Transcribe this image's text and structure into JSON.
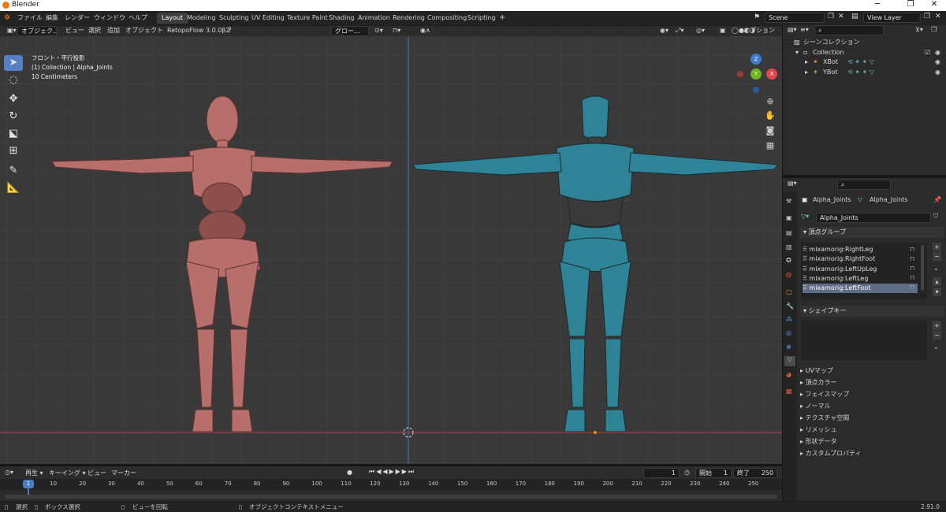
{
  "window": {
    "title": "Blender",
    "min": "─",
    "max": "❐",
    "close": "✕"
  },
  "menus": [
    "ファイル",
    "編集",
    "レンダー",
    "ウィンドウ",
    "ヘルプ"
  ],
  "workspaces": [
    "Layout",
    "Modeling",
    "Sculpting",
    "UV Editing",
    "Texture Paint",
    "Shading",
    "Animation",
    "Rendering",
    "Compositing",
    "Scripting",
    "+"
  ],
  "active_workspace": "Layout",
  "scene": {
    "name": "Scene",
    "view_layer": "View Layer"
  },
  "viewport_header": {
    "mode": "オブジェク...",
    "menus": [
      "ビュー",
      "選択",
      "追加",
      "オブジェクト"
    ],
    "addon": "RetopoFlow 3.0.0β2",
    "transform": "グロー...",
    "options": "オプション"
  },
  "overlay": {
    "view": "フロント・平行投影",
    "collection": "(1) Collection | Alpha_Joints",
    "scale": "10 Centimeters"
  },
  "gizmo_axes": {
    "z": "Z",
    "y": "Y",
    "x": "X"
  },
  "colors": {
    "accent": "#5680c2",
    "xbot": "#b86e6a",
    "ybot": "#2f8397",
    "x_axis": "#e0464b",
    "y_axis": "#6fb422",
    "z_axis": "#3d7ccd"
  },
  "outliner": {
    "root": "シーンコレクション",
    "collection": "Collection",
    "objects": [
      "XBot",
      "YBot"
    ]
  },
  "properties": {
    "object": "Alpha_Joints",
    "mesh": "Alpha_Joints",
    "data_name": "Alpha_Joints",
    "vertex_groups_title": "頂点グループ",
    "vertex_groups": [
      "mixamorig:RightLeg",
      "mixamorig:RightFoot",
      "mixamorig:LeftUpLeg",
      "mixamorig:LeftLeg",
      "mixamorig:LeftFoot"
    ],
    "selected_index": 4,
    "shape_keys_title": "シェイプキー",
    "subpanels": [
      "UVマップ",
      "頂点カラー",
      "フェイスマップ",
      "ノーマル",
      "テクスチャ空間",
      "リメッシュ",
      "形状データ",
      "カスタムプロパティ"
    ]
  },
  "timeline": {
    "menus": [
      "再生",
      "キーイング",
      "ビュー",
      "マーカー"
    ],
    "current_frame": "1",
    "start_label": "開始",
    "start": "1",
    "end_label": "終了",
    "end": "250",
    "ticks": [
      "1",
      "10",
      "20",
      "30",
      "40",
      "50",
      "60",
      "70",
      "80",
      "90",
      "100",
      "110",
      "120",
      "130",
      "140",
      "150",
      "160",
      "170",
      "180",
      "190",
      "200",
      "210",
      "220",
      "230",
      "240",
      "250"
    ]
  },
  "status": {
    "select": "選択",
    "box_select": "ボックス選択",
    "rotate_view": "ビューを回転",
    "context_menu": "オブジェクトコンテキストメニュー",
    "version": "2.91.0"
  }
}
